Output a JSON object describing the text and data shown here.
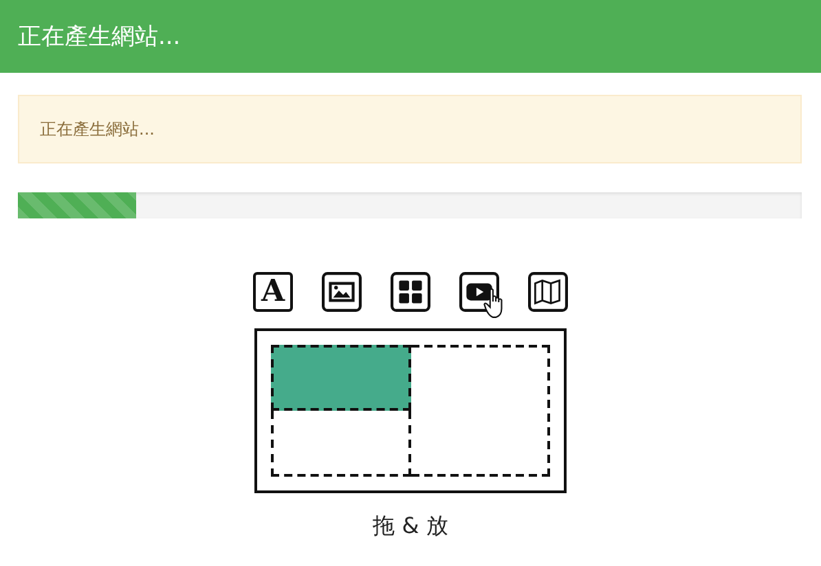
{
  "header": {
    "title": "正在產生網站..."
  },
  "alert": {
    "message": "正在產生網站..."
  },
  "progress": {
    "level": 0.15
  },
  "tools": [
    {
      "kind": "text",
      "glyph": "A",
      "hovered": false
    },
    {
      "kind": "image",
      "hovered": false
    },
    {
      "kind": "grid",
      "hovered": false
    },
    {
      "kind": "video",
      "hovered": true
    },
    {
      "kind": "map",
      "hovered": false
    }
  ],
  "layout": {
    "zones": [
      {
        "filled": true
      },
      {
        "filled": false
      },
      {
        "filled": false
      }
    ]
  },
  "caption": "拖 & 放"
}
